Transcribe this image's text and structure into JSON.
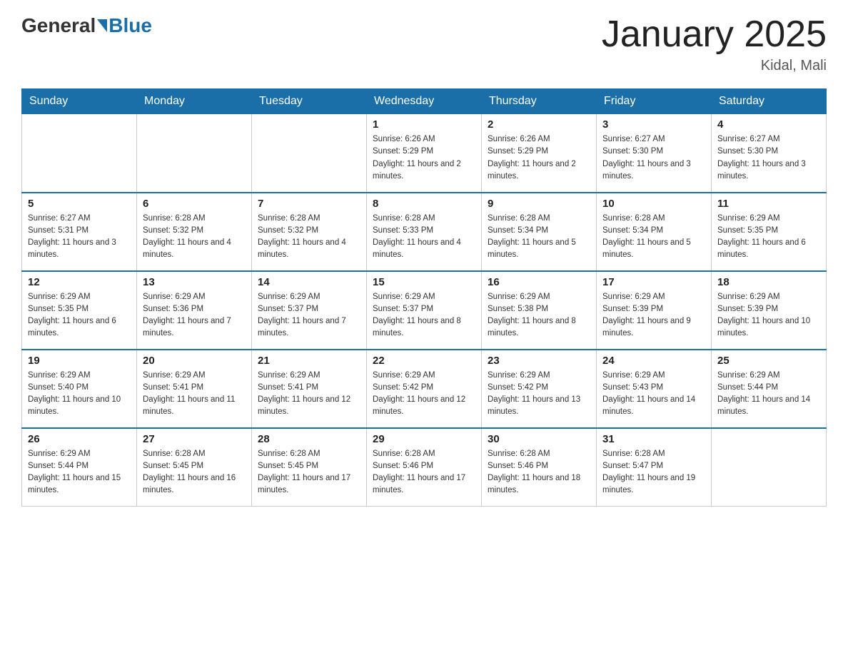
{
  "header": {
    "logo_general": "General",
    "logo_blue": "Blue",
    "title": "January 2025",
    "subtitle": "Kidal, Mali"
  },
  "days_of_week": [
    "Sunday",
    "Monday",
    "Tuesday",
    "Wednesday",
    "Thursday",
    "Friday",
    "Saturday"
  ],
  "weeks": [
    [
      {
        "day": "",
        "info": ""
      },
      {
        "day": "",
        "info": ""
      },
      {
        "day": "",
        "info": ""
      },
      {
        "day": "1",
        "info": "Sunrise: 6:26 AM\nSunset: 5:29 PM\nDaylight: 11 hours and 2 minutes."
      },
      {
        "day": "2",
        "info": "Sunrise: 6:26 AM\nSunset: 5:29 PM\nDaylight: 11 hours and 2 minutes."
      },
      {
        "day": "3",
        "info": "Sunrise: 6:27 AM\nSunset: 5:30 PM\nDaylight: 11 hours and 3 minutes."
      },
      {
        "day": "4",
        "info": "Sunrise: 6:27 AM\nSunset: 5:30 PM\nDaylight: 11 hours and 3 minutes."
      }
    ],
    [
      {
        "day": "5",
        "info": "Sunrise: 6:27 AM\nSunset: 5:31 PM\nDaylight: 11 hours and 3 minutes."
      },
      {
        "day": "6",
        "info": "Sunrise: 6:28 AM\nSunset: 5:32 PM\nDaylight: 11 hours and 4 minutes."
      },
      {
        "day": "7",
        "info": "Sunrise: 6:28 AM\nSunset: 5:32 PM\nDaylight: 11 hours and 4 minutes."
      },
      {
        "day": "8",
        "info": "Sunrise: 6:28 AM\nSunset: 5:33 PM\nDaylight: 11 hours and 4 minutes."
      },
      {
        "day": "9",
        "info": "Sunrise: 6:28 AM\nSunset: 5:34 PM\nDaylight: 11 hours and 5 minutes."
      },
      {
        "day": "10",
        "info": "Sunrise: 6:28 AM\nSunset: 5:34 PM\nDaylight: 11 hours and 5 minutes."
      },
      {
        "day": "11",
        "info": "Sunrise: 6:29 AM\nSunset: 5:35 PM\nDaylight: 11 hours and 6 minutes."
      }
    ],
    [
      {
        "day": "12",
        "info": "Sunrise: 6:29 AM\nSunset: 5:35 PM\nDaylight: 11 hours and 6 minutes."
      },
      {
        "day": "13",
        "info": "Sunrise: 6:29 AM\nSunset: 5:36 PM\nDaylight: 11 hours and 7 minutes."
      },
      {
        "day": "14",
        "info": "Sunrise: 6:29 AM\nSunset: 5:37 PM\nDaylight: 11 hours and 7 minutes."
      },
      {
        "day": "15",
        "info": "Sunrise: 6:29 AM\nSunset: 5:37 PM\nDaylight: 11 hours and 8 minutes."
      },
      {
        "day": "16",
        "info": "Sunrise: 6:29 AM\nSunset: 5:38 PM\nDaylight: 11 hours and 8 minutes."
      },
      {
        "day": "17",
        "info": "Sunrise: 6:29 AM\nSunset: 5:39 PM\nDaylight: 11 hours and 9 minutes."
      },
      {
        "day": "18",
        "info": "Sunrise: 6:29 AM\nSunset: 5:39 PM\nDaylight: 11 hours and 10 minutes."
      }
    ],
    [
      {
        "day": "19",
        "info": "Sunrise: 6:29 AM\nSunset: 5:40 PM\nDaylight: 11 hours and 10 minutes."
      },
      {
        "day": "20",
        "info": "Sunrise: 6:29 AM\nSunset: 5:41 PM\nDaylight: 11 hours and 11 minutes."
      },
      {
        "day": "21",
        "info": "Sunrise: 6:29 AM\nSunset: 5:41 PM\nDaylight: 11 hours and 12 minutes."
      },
      {
        "day": "22",
        "info": "Sunrise: 6:29 AM\nSunset: 5:42 PM\nDaylight: 11 hours and 12 minutes."
      },
      {
        "day": "23",
        "info": "Sunrise: 6:29 AM\nSunset: 5:42 PM\nDaylight: 11 hours and 13 minutes."
      },
      {
        "day": "24",
        "info": "Sunrise: 6:29 AM\nSunset: 5:43 PM\nDaylight: 11 hours and 14 minutes."
      },
      {
        "day": "25",
        "info": "Sunrise: 6:29 AM\nSunset: 5:44 PM\nDaylight: 11 hours and 14 minutes."
      }
    ],
    [
      {
        "day": "26",
        "info": "Sunrise: 6:29 AM\nSunset: 5:44 PM\nDaylight: 11 hours and 15 minutes."
      },
      {
        "day": "27",
        "info": "Sunrise: 6:28 AM\nSunset: 5:45 PM\nDaylight: 11 hours and 16 minutes."
      },
      {
        "day": "28",
        "info": "Sunrise: 6:28 AM\nSunset: 5:45 PM\nDaylight: 11 hours and 17 minutes."
      },
      {
        "day": "29",
        "info": "Sunrise: 6:28 AM\nSunset: 5:46 PM\nDaylight: 11 hours and 17 minutes."
      },
      {
        "day": "30",
        "info": "Sunrise: 6:28 AM\nSunset: 5:46 PM\nDaylight: 11 hours and 18 minutes."
      },
      {
        "day": "31",
        "info": "Sunrise: 6:28 AM\nSunset: 5:47 PM\nDaylight: 11 hours and 19 minutes."
      },
      {
        "day": "",
        "info": ""
      }
    ]
  ]
}
